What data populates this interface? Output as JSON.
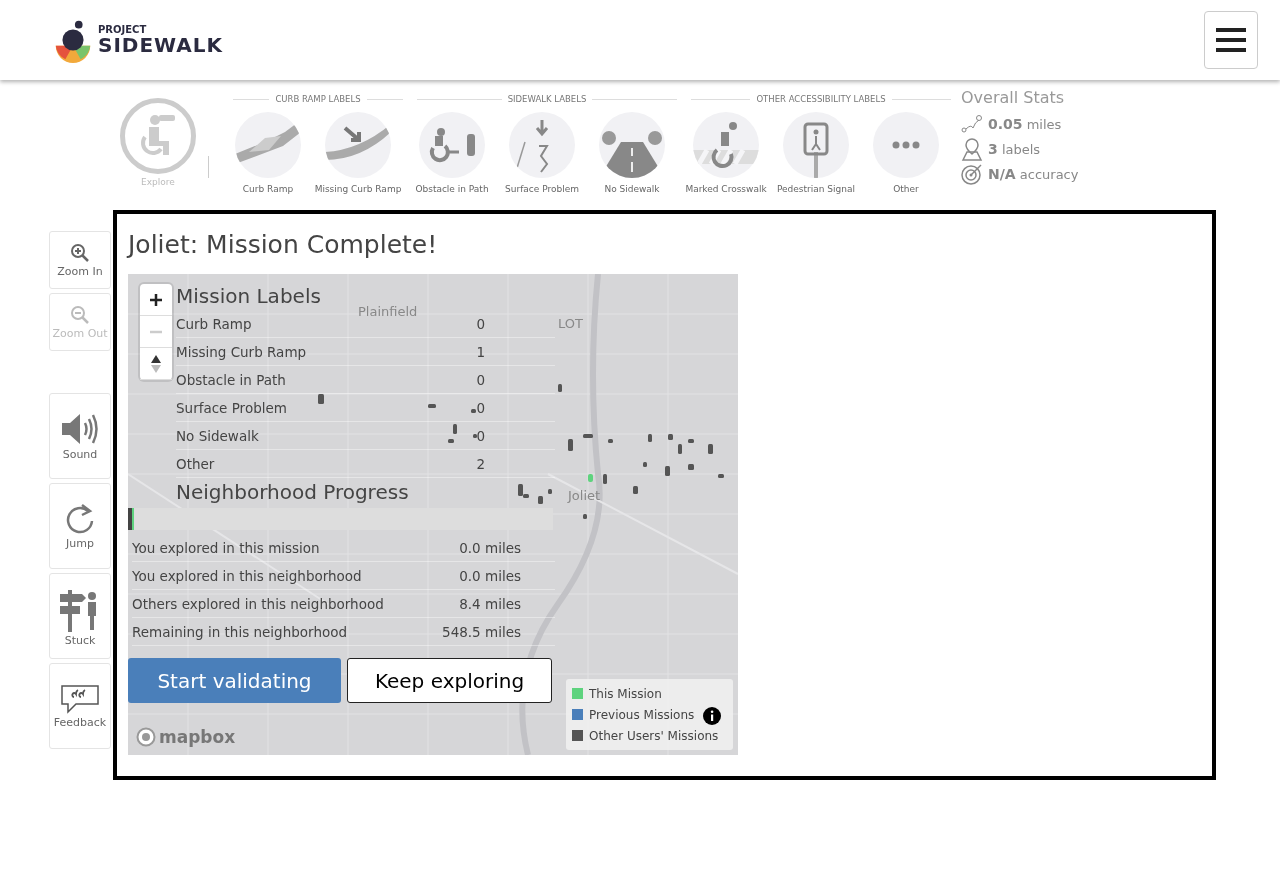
{
  "header": {
    "logo_top": "PROJECT",
    "logo_bottom": "SIDEWALK"
  },
  "toolbar": {
    "explore": {
      "label": "Explore",
      "selected": true
    },
    "groups": [
      {
        "title": "CURB RAMP LABELS",
        "labels": [
          {
            "label": "Curb Ramp",
            "kind": "curb-ramp"
          },
          {
            "label": "Missing Curb Ramp",
            "kind": "missing-curb-ramp"
          }
        ]
      },
      {
        "title": "SIDEWALK LABELS",
        "labels": [
          {
            "label": "Obstacle in Path",
            "kind": "obstacle"
          },
          {
            "label": "Surface Problem",
            "kind": "surface-problem"
          },
          {
            "label": "No Sidewalk",
            "kind": "no-sidewalk"
          }
        ]
      },
      {
        "title": "OTHER ACCESSIBILITY LABELS",
        "labels": [
          {
            "label": "Marked Crosswalk",
            "kind": "crosswalk"
          },
          {
            "label": "Pedestrian Signal",
            "kind": "signal"
          },
          {
            "label": "Other",
            "kind": "other"
          }
        ]
      }
    ]
  },
  "overall_stats": {
    "title": "Overall Stats",
    "items": [
      {
        "kind": "distance",
        "value": "0.05",
        "unit": "miles"
      },
      {
        "kind": "labels",
        "value": "3",
        "unit": "labels"
      },
      {
        "kind": "accuracy",
        "value": "N/A",
        "unit": "accuracy"
      }
    ]
  },
  "sidebar": [
    {
      "label": "Zoom In",
      "kind": "zoom-in",
      "disabled": false
    },
    {
      "label": "Zoom Out",
      "kind": "zoom-out",
      "disabled": true
    },
    {
      "label": "Sound",
      "kind": "sound",
      "disabled": false
    },
    {
      "label": "Jump",
      "kind": "jump",
      "disabled": false
    },
    {
      "label": "Stuck",
      "kind": "stuck",
      "disabled": false
    },
    {
      "label": "Feedback",
      "kind": "feedback",
      "disabled": false
    }
  ],
  "modal": {
    "title": "Joliet: Mission Complete!",
    "map_places": [
      "Plainfield",
      "LOT",
      "Joliet"
    ],
    "mission_labels": {
      "title": "Mission Labels",
      "rows": [
        {
          "label": "Curb Ramp",
          "count": "0"
        },
        {
          "label": "Missing Curb Ramp",
          "count": "1"
        },
        {
          "label": "Obstacle in Path",
          "count": "0"
        },
        {
          "label": "Surface Problem",
          "count": "0"
        },
        {
          "label": "No Sidewalk",
          "count": "0"
        },
        {
          "label": "Other",
          "count": "2"
        }
      ]
    },
    "progress": {
      "title": "Neighborhood Progress",
      "level": 0.015,
      "rows": [
        {
          "label": "You explored in this mission",
          "value": "0.0 miles"
        },
        {
          "label": "You explored in this neighborhood",
          "value": "0.0 miles"
        },
        {
          "label": "Others explored in this neighborhood",
          "value": "8.4 miles"
        },
        {
          "label": "Remaining in this neighborhood",
          "value": "548.5 miles"
        }
      ]
    },
    "buttons": [
      {
        "label": "Start validating",
        "kind": "primary"
      },
      {
        "label": "Keep exploring",
        "kind": "secondary"
      }
    ],
    "attribution": "mapbox",
    "legend": [
      {
        "label": "This Mission",
        "color": "#5ed37e"
      },
      {
        "label": "Previous Missions",
        "color": "#4a7fba"
      },
      {
        "label": "Other Users' Missions",
        "color": "#555555"
      }
    ]
  }
}
